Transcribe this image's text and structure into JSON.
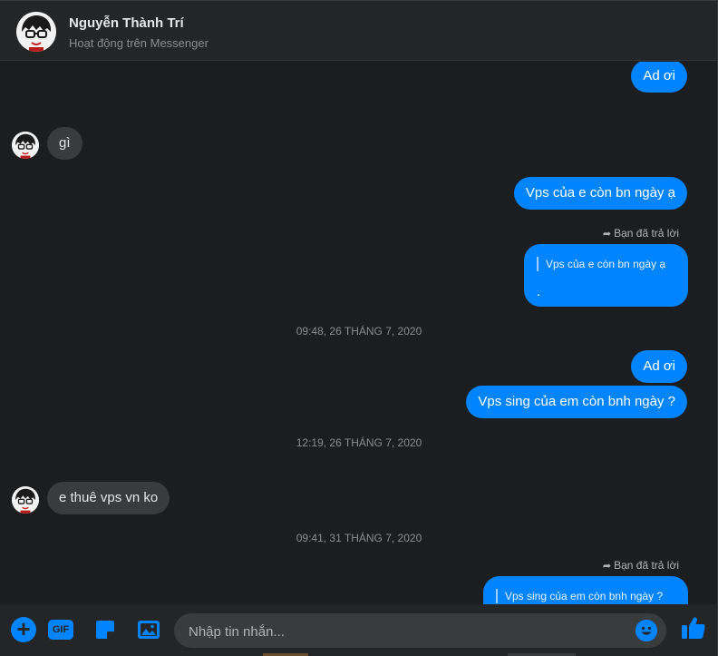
{
  "header": {
    "name": "Nguyễn Thành Trí",
    "status": "Hoạt động trên Messenger"
  },
  "messages": {
    "m1": "Ad ơi",
    "m2": "gì",
    "m3": "Vps của e còn bn ngày ạ",
    "reply1": {
      "tag": "Bạn đã trả lời",
      "quote": "Vps của e còn bn ngày ạ",
      "body": "."
    },
    "ts1": "09:48, 26 THÁNG 7, 2020",
    "m4": "Ad ơi",
    "m5": "Vps sing của em còn bnh ngày ?",
    "ts2": "12:19, 26 THÁNG 7, 2020",
    "m6": "e thuê vps vn ko",
    "ts3": "09:41, 31 THÁNG 7, 2020",
    "reply2": {
      "tag": "Bạn đã trả lời",
      "quote": "Vps sing của em còn bnh ngày ?"
    }
  },
  "composer": {
    "gif_label": "GIF",
    "placeholder": "Nhập tin nhắn..."
  },
  "colors": {
    "accent": "#0084ff",
    "background": "#1c1d1f",
    "incoming_bubble": "#3a3b3c"
  },
  "icons": {
    "add": "plus-icon",
    "gif": "gif-icon",
    "sticker": "sticker-icon",
    "image": "image-icon",
    "emoji": "emoji-icon",
    "like": "thumbs-up-icon",
    "reply": "reply-arrow-icon"
  }
}
